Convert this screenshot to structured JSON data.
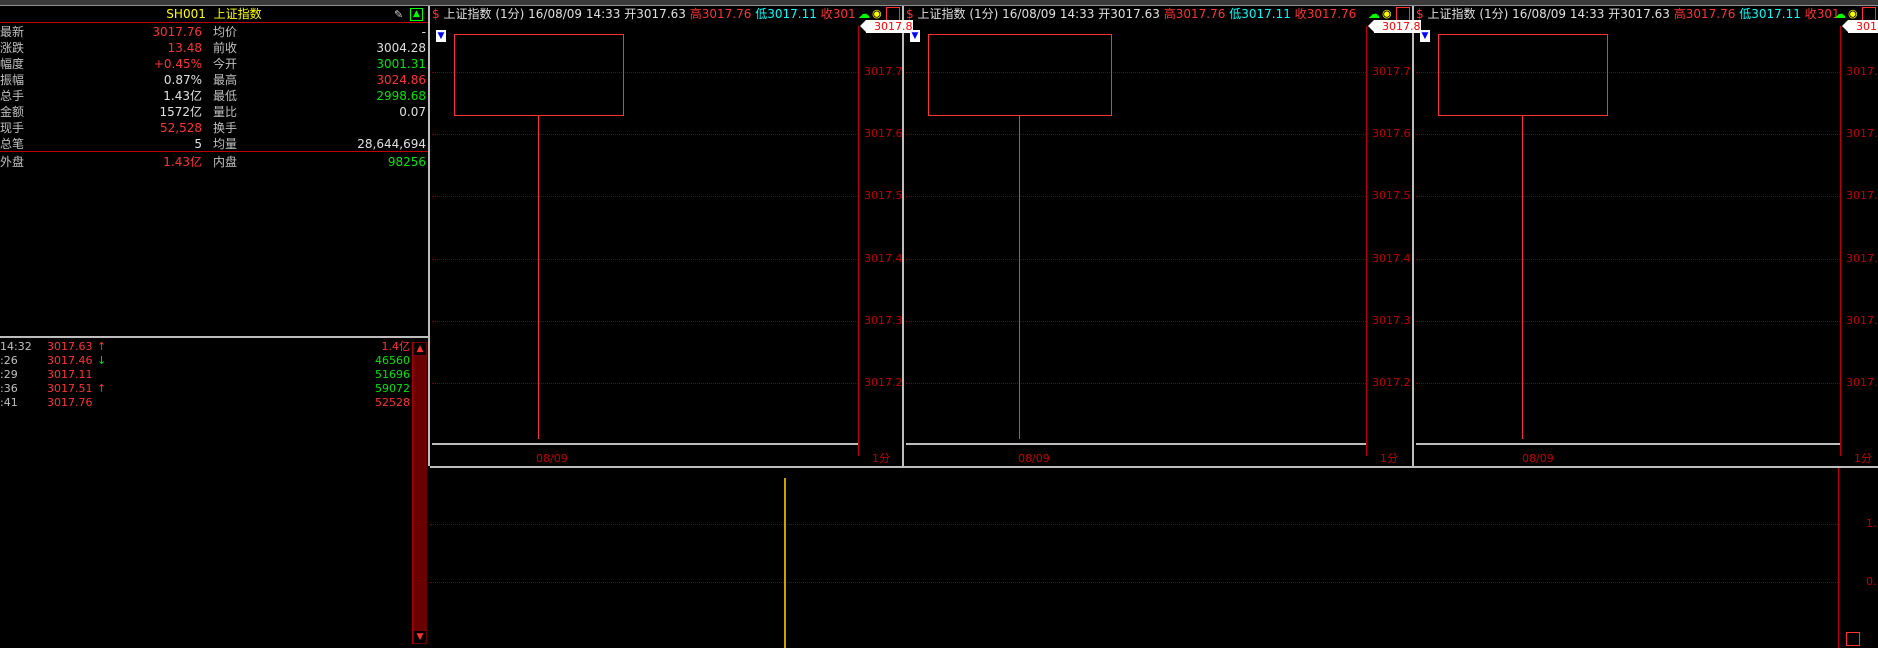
{
  "quote": {
    "code": "SH001",
    "name": "上证指数",
    "rows": [
      {
        "l1": "最新",
        "v1": "3017.76",
        "c1": "red",
        "l2": "均价",
        "v2": "-",
        "c2": "white"
      },
      {
        "l1": "涨跌",
        "v1": "13.48",
        "c1": "red",
        "l2": "前收",
        "v2": "3004.28",
        "c2": "white"
      },
      {
        "l1": "幅度",
        "v1": "+0.45%",
        "c1": "red",
        "l2": "今开",
        "v2": "3001.31",
        "c2": "green"
      },
      {
        "l1": "振幅",
        "v1": "0.87%",
        "c1": "white",
        "l2": "最高",
        "v2": "3024.86",
        "c2": "red"
      },
      {
        "l1": "总手",
        "v1": "1.43亿",
        "c1": "white",
        "l2": "最低",
        "v2": "2998.68",
        "c2": "green"
      },
      {
        "l1": "金额",
        "v1": "1572亿",
        "c1": "white",
        "l2": "量比",
        "v2": "0.07",
        "c2": "white"
      },
      {
        "l1": "现手",
        "v1": "52,528",
        "c1": "red",
        "l2": "换手",
        "v2": "",
        "c2": "white"
      },
      {
        "l1": "总笔",
        "v1": "5",
        "c1": "white",
        "l2": "均量",
        "v2": "28,644,694",
        "c2": "white"
      }
    ],
    "outer": {
      "l1": "外盘",
      "v1": "1.43亿",
      "l2": "内盘",
      "v2": "98256"
    }
  },
  "ticks": [
    {
      "time": "14:32",
      "price": "3017.63",
      "arrow": "↑",
      "arrow_color": "red",
      "vol": "1.4亿",
      "vol_color": "red"
    },
    {
      "time": ":26",
      "price": "3017.46",
      "arrow": "↓",
      "arrow_color": "green",
      "vol": "46560",
      "vol_color": "green"
    },
    {
      "time": ":29",
      "price": "3017.11",
      "arrow": "",
      "arrow_color": "red",
      "vol": "51696",
      "vol_color": "green"
    },
    {
      "time": ":36",
      "price": "3017.51",
      "arrow": "↑",
      "arrow_color": "red",
      "vol": "59072",
      "vol_color": "green"
    },
    {
      "time": ":41",
      "price": "3017.76",
      "arrow": "",
      "arrow_color": "red",
      "vol": "52528",
      "vol_color": "red"
    }
  ],
  "chart_header": {
    "name": "上证指数",
    "period": "(1分)",
    "datetime": "16/08/09 14:33",
    "open_label": "开",
    "open": "3017.63",
    "high_label": "高",
    "high": "3017.76",
    "low_label": "低",
    "low": "3017.11",
    "close_label": "收",
    "close_partial": "301",
    "close_partial2": "3017.76"
  },
  "chart_y_labels": [
    "3017.7",
    "3017.6",
    "3017.5",
    "3017.4",
    "3017.3",
    "3017.2"
  ],
  "price_tag": "3017.8",
  "price_tag_short": "3017.",
  "x_label": "08/09",
  "period_label": "1分",
  "vol_y_labels": [
    "1.",
    "0."
  ],
  "colors": {
    "up": "#ff3232",
    "down": "#00e600",
    "accent": "#ffff00",
    "grid": "#7a0000"
  }
}
